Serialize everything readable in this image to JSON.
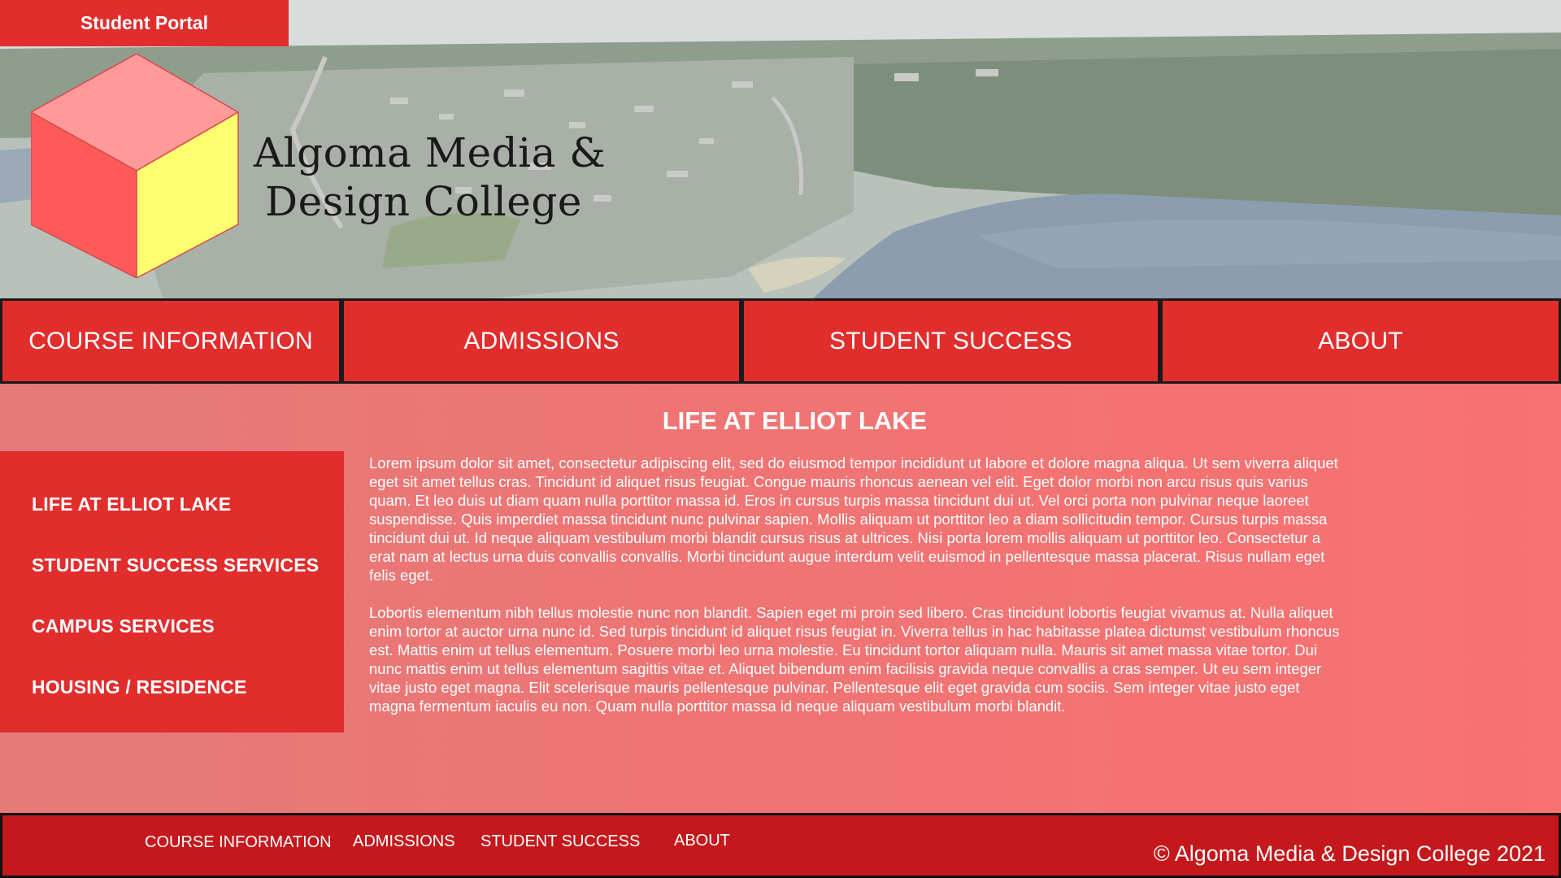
{
  "header": {
    "portal_button": "Student Portal",
    "logo_line1": "Algoma Media &",
    "logo_line2": "Design College"
  },
  "main_nav": [
    {
      "label": "COURSE INFORMATION"
    },
    {
      "label": "ADMISSIONS"
    },
    {
      "label": "STUDENT SUCCESS"
    },
    {
      "label": "ABOUT"
    }
  ],
  "content": {
    "title": "LIFE AT ELLIOT LAKE",
    "side_menu": [
      {
        "label": "LIFE AT ELLIOT LAKE"
      },
      {
        "label": "STUDENT SUCCESS SERVICES"
      },
      {
        "label": "CAMPUS SERVICES"
      },
      {
        "label": "HOUSING / RESIDENCE"
      }
    ],
    "paragraphs": [
      "Lorem ipsum dolor sit amet, consectetur adipiscing elit, sed do eiusmod tempor incididunt ut labore et dolore magna aliqua. Ut sem viverra aliquet eget sit amet tellus cras. Tincidunt id aliquet risus feugiat. Congue mauris rhoncus aenean vel elit. Eget dolor morbi non arcu risus quis varius quam. Et leo duis ut diam quam nulla porttitor massa id. Eros in cursus turpis massa tincidunt dui ut. Vel orci porta non pulvinar neque laoreet suspendisse. Quis imperdiet massa tincidunt nunc pulvinar sapien. Mollis aliquam ut porttitor leo a diam sollicitudin tempor. Cursus turpis massa tincidunt dui ut. Id neque aliquam vestibulum morbi blandit cursus risus at ultrices. Nisi porta lorem mollis aliquam ut porttitor leo. Consectetur a erat nam at lectus urna duis convallis convallis. Morbi tincidunt augue interdum velit euismod in pellentesque massa placerat. Risus nullam eget felis eget.",
      "Lobortis elementum nibh tellus molestie nunc non blandit. Sapien eget mi proin sed libero. Cras tincidunt lobortis feugiat vivamus at. Nulla aliquet enim tortor at auctor urna nunc id. Sed turpis tincidunt id aliquet risus feugiat in. Viverra tellus in hac habitasse platea dictumst vestibulum rhoncus est. Mattis enim ut tellus elementum. Posuere morbi leo urna molestie. Eu tincidunt tortor aliquam nulla. Mauris sit amet massa vitae tortor. Dui nunc mattis enim ut tellus elementum sagittis vitae et. Aliquet bibendum enim facilisis gravida neque convallis a cras semper. Ut eu sem integer vitae justo eget magna. Elit scelerisque mauris pellentesque pulvinar. Pellentesque elit eget gravida cum sociis. Sem integer vitae justo eget magna fermentum iaculis eu non. Quam nulla porttitor massa id neque aliquam vestibulum morbi blandit."
    ]
  },
  "footer": {
    "nav": [
      {
        "label": "COURSE INFORMATION"
      },
      {
        "label": "ADMISSIONS"
      },
      {
        "label": "STUDENT SUCCESS"
      },
      {
        "label": "ABOUT"
      }
    ],
    "copyright": "© Algoma Media & Design College 2021"
  },
  "colors": {
    "primary_red": "#e22d2d",
    "footer_red": "#c4181c",
    "content_pink": "#f47070",
    "logo_cube_left": "#ff5a5a",
    "logo_cube_top": "#ff9a9a",
    "logo_cube_right": "#ffff70"
  },
  "icons": {
    "logo": "isometric-cube-icon",
    "hero": "aerial-town-lake-photo"
  }
}
